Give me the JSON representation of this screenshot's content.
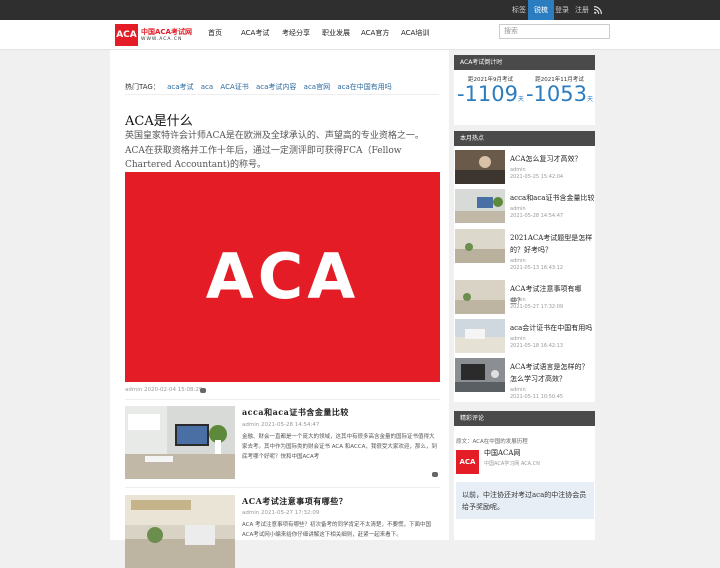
{
  "topbar": {
    "tags": "标签",
    "theme": "锐梳",
    "login": "登录",
    "register": "注册"
  },
  "logo": {
    "mark": "ACA",
    "cn": "中国ACA考试网",
    "en": "WWW.ACA.CN"
  },
  "nav": [
    "首页",
    "ACA考试",
    "考经分享",
    "职业发展",
    "ACA官方",
    "ACA培训"
  ],
  "search": {
    "placeholder": "搜索"
  },
  "tags": {
    "label": "热门TAG：",
    "items": [
      "aca考试",
      "aca",
      "ACA证书",
      "aca考试内容",
      "aca官网",
      "aca在中国有用吗"
    ]
  },
  "article": {
    "title": "ACA是什么",
    "intro": "英国皇家特许会计师ACA是在欧洲及全球承认的、声望高的专业资格之一。ACA在获取资格并工作十年后，通过一定测评即可获得FCA（Fellow Chartered Accountant)的称号。",
    "hero_text": "ACA",
    "meta": "admin   2020-02-04 15:08:29"
  },
  "posts": [
    {
      "title": "acca和aca证书含金量比较",
      "meta": "admin   2021-05-28 14:54:47",
      "excerpt": "金融、财会一直都是一个庞大的领域，这其中有很多高含金量的国际证书值得大家去考。其中作为国际类的财会证书 ACA 和ACCA，我很受大家欢迎，那么，到底考哪个好呢？快和中国ACA考"
    },
    {
      "title": "ACA考试注意事项有哪些？",
      "meta": "admin   2021-05-27 17:32:09",
      "excerpt": "ACA 考试注意事项有哪些？初次备考的同学肯定不太清楚，不要慌，下面中国ACA考试网小编来给你仔细讲解这下相关细则，赶紧一起来看下。"
    }
  ],
  "countdown": {
    "title": "ACA考试倒计时",
    "items": [
      {
        "label": "距2021年9月考试",
        "num": "-1109",
        "unit": "天"
      },
      {
        "label": "距2021年11月考试",
        "num": "-1053",
        "unit": "天"
      }
    ]
  },
  "hot": {
    "title": "本月热点",
    "items": [
      {
        "title": "ACA怎么复习才高效？",
        "author": "admin",
        "date": "2021-05-25 15:42:04"
      },
      {
        "title": "acca和aca证书含金量比较",
        "author": "admin",
        "date": "2021-05-28 14:54:47"
      },
      {
        "title": "2021ACA考试题型是怎样的？好考吗？",
        "author": "admin",
        "date": "2021-05-13 16:43:12"
      },
      {
        "title": "ACA考试注意事项有哪些？",
        "author": "admin",
        "date": "2021-05-27 17:32:09"
      },
      {
        "title": "aca会计证书在中国有用吗",
        "author": "admin",
        "date": "2021-05-18 16:42:13"
      },
      {
        "title": "ACA考试语言是怎样的？怎么学习才高效？",
        "author": "admin",
        "date": "2021-05-11 10:50:45"
      }
    ]
  },
  "comments": {
    "title": "精彩评论",
    "source": "原文：ACA在中国的发展历程",
    "logo": "ACA",
    "name": "中国ACA网",
    "sub": "中国ACA学习网 ACA.CN",
    "body": "以前，中注协还对考过aca的中注协会员给予奖励呢。"
  },
  "colors": {
    "brand_red": "#e31c25",
    "accent_blue": "#2b7dc0",
    "side_header": "#4a4a4a",
    "topbar": "#2f2f2f"
  }
}
